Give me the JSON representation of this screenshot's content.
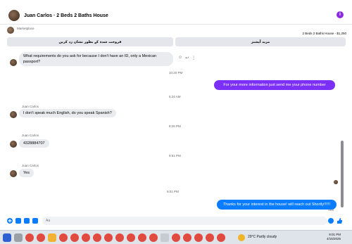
{
  "header": {
    "title": "Juan Carlos · 2 Beds 2 Baths House",
    "info_glyph": "i"
  },
  "marketplace": {
    "label": "Marketplace",
    "listing": "2 Beds 2 Baths House - $1,250",
    "btn_mark_sold": "فروخت شدہ کے بطور نشان زد کریں",
    "btn_more_info": "مزید آپشنز"
  },
  "messages": {
    "m1_text": "What requirements do you ask for because I don't have an ID, only a Mexican passport?",
    "ts1": "10:20 PM",
    "m2_text": "For your more information just send me your phone number",
    "ts2": "5:24 AM",
    "sender": "Juan Carlos",
    "m3_text": "I don't speak much English, do you speak Spanish?",
    "ts3": "8:26 PM",
    "m4_text": "4328884707",
    "ts4": "9:51 PM",
    "m5_text": "Yes",
    "ts5": "9:01 PM",
    "m6_text": "Thanks for your interest in the house! will reach out Shortly!!!!!!",
    "sent": "Sent"
  },
  "composer": {
    "placeholder": "Aa"
  },
  "taskbar": {
    "weather": "29°C  Partly cloudy",
    "time": "9:01 PM",
    "date": "4/15/2025"
  },
  "colors": {
    "accent": "#0a7cff",
    "purple": "#7b2ff7",
    "bubble_in": "#e9ebee"
  }
}
